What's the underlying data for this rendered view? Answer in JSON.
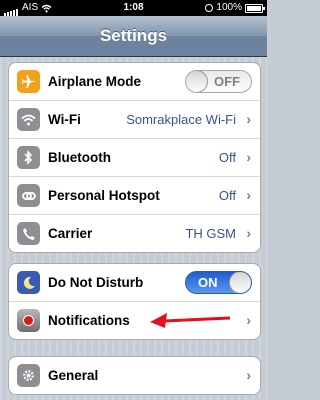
{
  "status": {
    "carrier": "AIS",
    "time": "1:08",
    "battery": "100%",
    "signal_bars": 5
  },
  "navbar": {
    "title": "Settings"
  },
  "colors": {
    "airplane": "#f2a11d",
    "wifi": "#8e8e93",
    "bluetooth": "#8e8e93",
    "hotspot": "#8e8e93",
    "carrier": "#8e8e93",
    "dnd": "#3a5bb4",
    "notifications": "#8a8a8a",
    "general": "#8e8e93",
    "annotation_arrow": "#e3101d",
    "toggle_on": "#2f7be8",
    "value_text": "#385487"
  },
  "groups": [
    {
      "rows": [
        {
          "label": "Airplane Mode",
          "icon": "airplane-icon",
          "toggle": "OFF"
        },
        {
          "label": "Wi-Fi",
          "icon": "wifi-icon",
          "value": "Somrakplace Wi-Fi",
          "chevron": true
        },
        {
          "label": "Bluetooth",
          "icon": "bluetooth-icon",
          "value": "Off",
          "chevron": true
        },
        {
          "label": "Personal Hotspot",
          "icon": "hotspot-icon",
          "value": "Off",
          "chevron": true
        },
        {
          "label": "Carrier",
          "icon": "phone-icon",
          "value": "TH GSM",
          "chevron": true
        }
      ]
    },
    {
      "rows": [
        {
          "label": "Do Not Disturb",
          "icon": "moon-icon",
          "toggle": "ON"
        },
        {
          "label": "Notifications",
          "icon": "notifications-icon",
          "chevron": true
        }
      ]
    },
    {
      "rows": [
        {
          "label": "General",
          "icon": "gear-icon",
          "chevron": true
        }
      ]
    }
  ]
}
